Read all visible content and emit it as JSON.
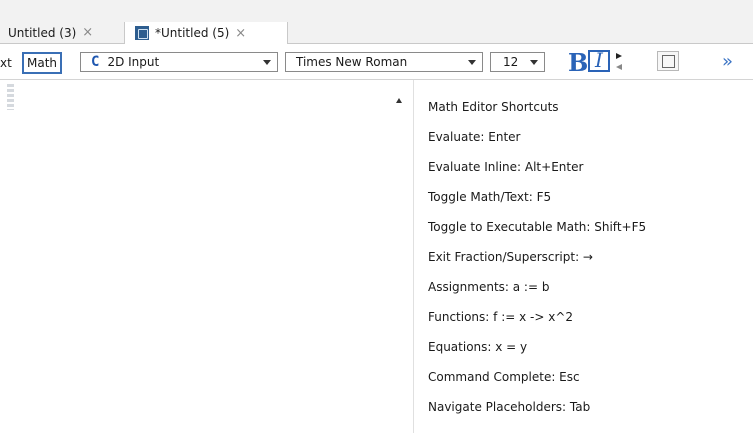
{
  "tabs": [
    {
      "label": "Untitled (3)",
      "close": "×"
    },
    {
      "label": "*Untitled (5)",
      "close": "×"
    }
  ],
  "toolbar": {
    "text_mode_label": "xt",
    "math_mode_label": "Math",
    "input_mode_glyph": "C",
    "input_mode_value": "2D Input",
    "font_value": "Times New Roman",
    "size_value": "12",
    "bold_label": "B",
    "italic_label": "I",
    "more_label": "»"
  },
  "shortcuts_panel": {
    "title": "Math Editor Shortcuts",
    "items": [
      "Evaluate:  Enter",
      "Evaluate Inline:  Alt+Enter",
      "Toggle Math/Text:  F5",
      "Toggle to Executable Math:  Shift+F5",
      "Exit Fraction/Superscript:  →",
      "Assignments:  a := b",
      "Functions:  f := x -> x^2",
      "Equations:  x = y",
      "Command Complete:  Esc",
      "Navigate Placeholders:  Tab"
    ]
  },
  "colors": {
    "accent": "#2a63b7",
    "tab_bar": "#f2f2f2"
  }
}
